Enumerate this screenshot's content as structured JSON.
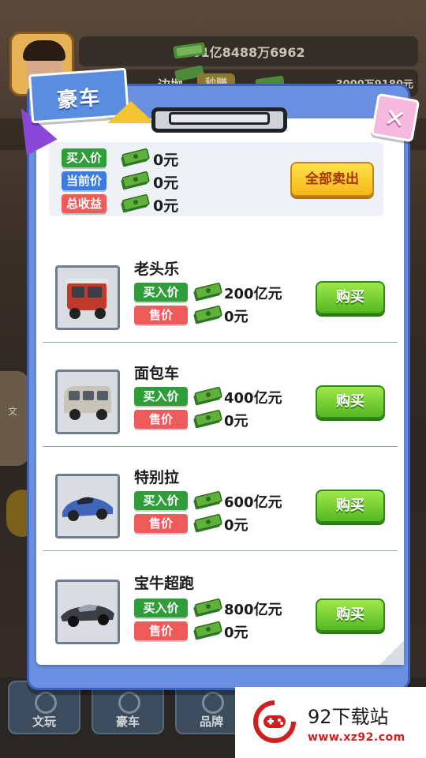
{
  "hud": {
    "total_money": "61亿8488万6962",
    "income_left": "边抛",
    "income_tag": "秒赚",
    "income_rate": "3000万9180元"
  },
  "side": {
    "left_label": "文"
  },
  "modal": {
    "title": "豪车",
    "close_symbol": "✕",
    "summary": {
      "buy_label": "买入价",
      "buy_value": "0元",
      "current_label": "当前价",
      "current_value": "0元",
      "profit_label": "总收益",
      "profit_value": "0元",
      "sell_all_label": "全部卖出"
    },
    "items": [
      {
        "name": "老头乐",
        "buy_label": "买入价",
        "buy_price": "200亿元",
        "sell_label": "售价",
        "sell_price": "0元",
        "button": "购买",
        "icon": "tuk-tuk-car-icon"
      },
      {
        "name": "面包车",
        "buy_label": "买入价",
        "buy_price": "400亿元",
        "sell_label": "售价",
        "sell_price": "0元",
        "button": "购买",
        "icon": "van-icon"
      },
      {
        "name": "特别拉",
        "buy_label": "买入价",
        "buy_price": "600亿元",
        "sell_label": "售价",
        "sell_price": "0元",
        "button": "购买",
        "icon": "sports-car-icon"
      },
      {
        "name": "宝牛超跑",
        "buy_label": "买入价",
        "buy_price": "800亿元",
        "sell_label": "售价",
        "sell_price": "0元",
        "button": "购买",
        "icon": "supercar-icon"
      }
    ]
  },
  "dock": {
    "tabs": [
      {
        "label": "文玩"
      },
      {
        "label": "豪车"
      },
      {
        "label": "品牌"
      }
    ]
  },
  "watermark": {
    "title": "92下载站",
    "url": "www.xz92.com"
  },
  "colors": {
    "modal_blue": "#6b8fe0",
    "buy_tag_green": "#2f9e3a",
    "current_tag_blue": "#3c7ce0",
    "sell_tag_red": "#ef5a5a",
    "buy_button_green": "#56b824",
    "sell_all_yellow": "#f6b81a"
  }
}
